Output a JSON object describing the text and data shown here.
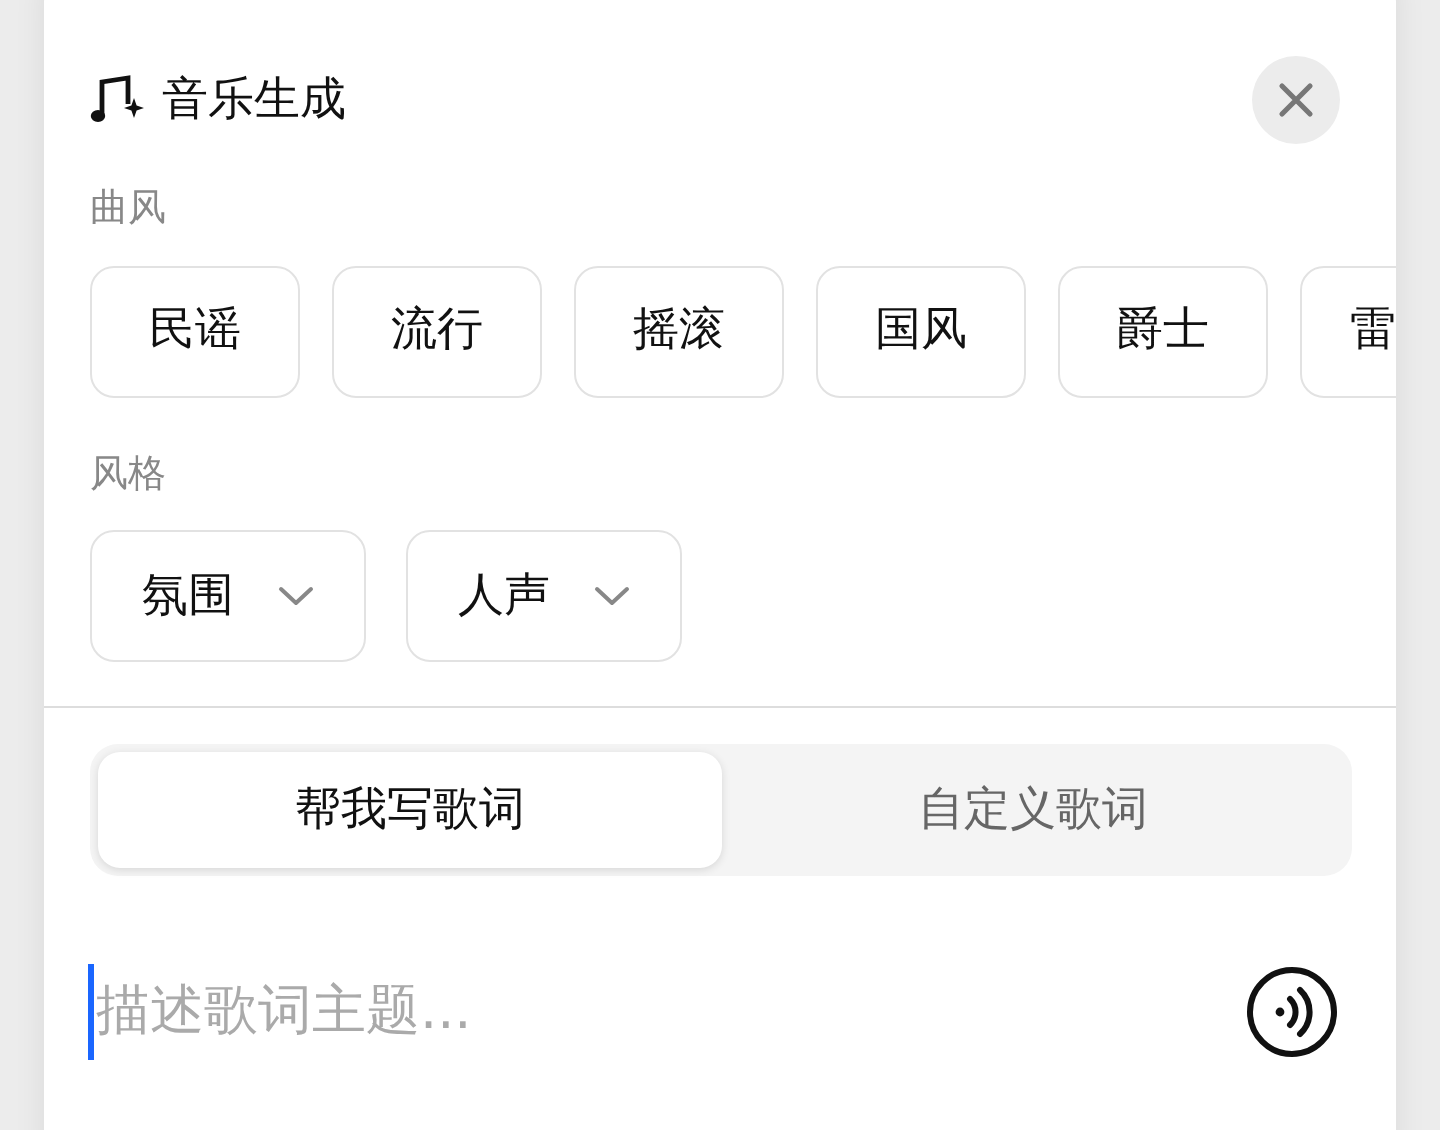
{
  "header": {
    "title": "音乐生成"
  },
  "genre": {
    "label": "曲风",
    "chips": [
      {
        "label": "民谣"
      },
      {
        "label": "流行"
      },
      {
        "label": "摇滚"
      },
      {
        "label": "国风"
      },
      {
        "label": "爵士"
      },
      {
        "label": "雷"
      }
    ]
  },
  "style": {
    "label": "风格",
    "dropdowns": [
      {
        "label": "氛围"
      },
      {
        "label": "人声"
      }
    ]
  },
  "tabs": [
    {
      "label": "帮我写歌词",
      "selected": true
    },
    {
      "label": "自定义歌词",
      "selected": false
    }
  ],
  "input": {
    "placeholder": "描述歌词主题..."
  }
}
